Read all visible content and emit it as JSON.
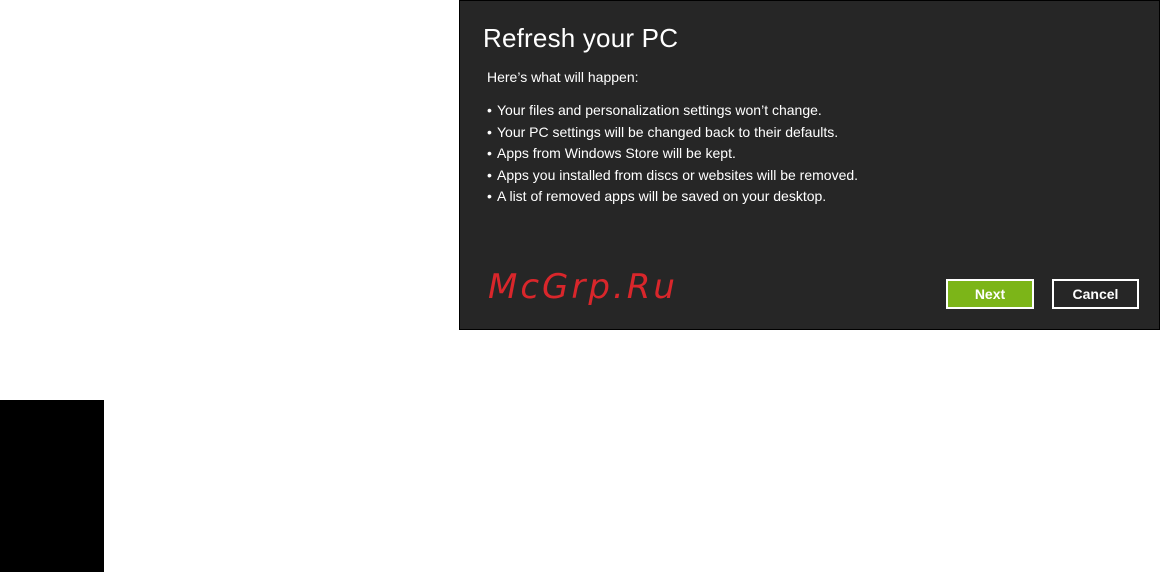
{
  "dialog": {
    "title": "Refresh your PC",
    "intro": "Here’s what will happen:",
    "bullet_symbol": "•",
    "bullets": [
      "Your files and personalization settings won’t change.",
      "Your PC settings will be changed back to their defaults.",
      "Apps from Windows Store will be kept.",
      "Apps you installed from discs or websites will be removed.",
      "A list of removed apps will be saved on your desktop."
    ],
    "buttons": {
      "next_label": "Next",
      "cancel_label": "Cancel"
    }
  },
  "watermark": "McGrp.Ru",
  "colors": {
    "dialog_background": "#262626",
    "next_button": "#7cb518",
    "watermark": "#d9262b"
  }
}
